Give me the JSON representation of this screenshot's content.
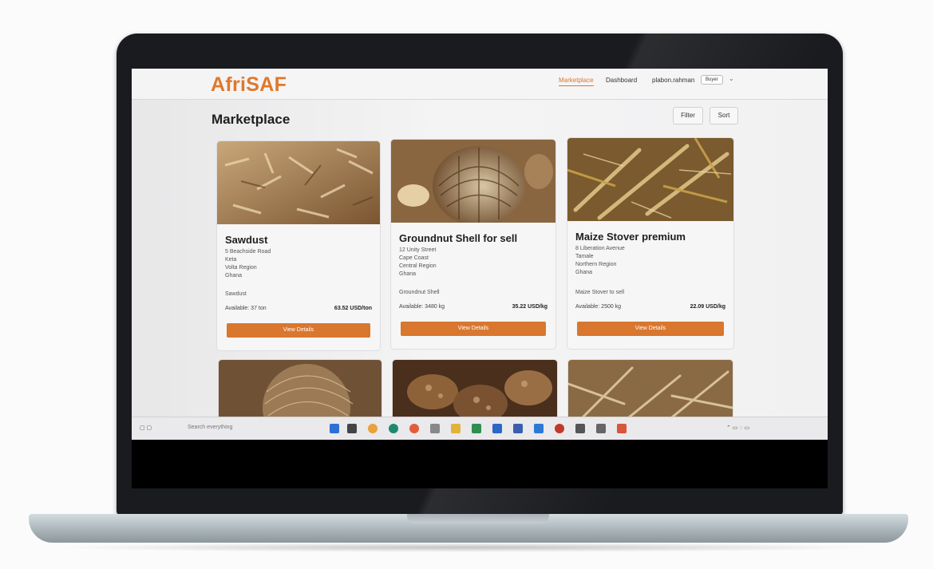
{
  "app": {
    "brand": "AfriSAF"
  },
  "nav": {
    "marketplace": "Marketplace",
    "dashboard": "Dashboard",
    "username": "plabon.rahman",
    "role": "Buyer"
  },
  "page": {
    "title": "Marketplace",
    "filter_label": "Filter",
    "sort_label": "Sort"
  },
  "listings": [
    {
      "title": "Sawdust",
      "address": [
        "5 Beachside Road",
        "Keta",
        "Volta Region",
        "Ghana"
      ],
      "description": "Sawdust",
      "available": "Available: 37 ton",
      "price": "63.52 USD/ton",
      "button": "View Details"
    },
    {
      "title": "Groundnut Shell for sell",
      "address": [
        "12 Unity Street",
        "Cape Coast",
        "Central Region",
        "Ghana"
      ],
      "description": "Groundnut Shell",
      "available": "Available: 3480 kg",
      "price": "35.22 USD/kg",
      "button": "View Details"
    },
    {
      "title": "Maize Stover premium",
      "address": [
        "8 Liberation Avenue",
        "Tamale",
        "Northern Region",
        "Ghana"
      ],
      "description": "Maize Stover to sell",
      "available": "Available: 2500 kg",
      "price": "22.09 USD/kg",
      "button": "View Details"
    }
  ],
  "colors": {
    "accent": "#d9772f",
    "brand": "#e0782b"
  },
  "taskbar": {
    "search_placeholder": "Search everything"
  }
}
